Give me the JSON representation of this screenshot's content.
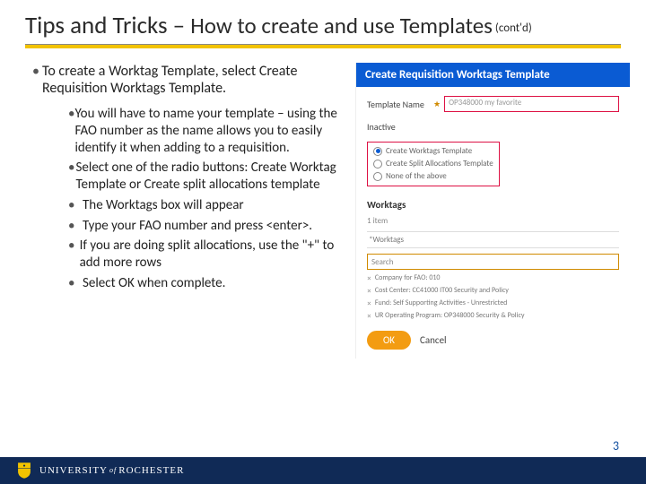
{
  "title": {
    "part1": "Tips and Tricks",
    "sep": " – ",
    "part2": "How to create and use Templates",
    "cont": " (cont'd)"
  },
  "bullets": {
    "top": "To create a Worktag Template, select Create Requisition Worktags Template.",
    "subs": [
      "You will have to name your template – using the FAO number as the name allows you to easily identify it when adding to a requisition.",
      "Select one of the radio buttons: Create Worktag Template or Create split allocations template",
      "The Worktags box will appear",
      "Type your FAO number and press <enter>.",
      "If you are doing split allocations, use the \"+\" to add more rows",
      "Select OK when complete."
    ]
  },
  "panel": {
    "header": "Create Requisition Worktags Template",
    "templateNameLabel": "Template Name",
    "templateNameValue": "OP348000 my favorite",
    "inactiveLabel": "Inactive",
    "radios": [
      "Create Worktags Template",
      "Create Split Allocations Template",
      "None of the above"
    ],
    "worktagsLabel": "Worktags",
    "itemsCount": "1 item",
    "wkHead": "*Worktags",
    "searchPlaceholder": "Search",
    "lines": [
      "Company for FAO: 010",
      "Cost Center: CC41000 IT00 Security and Policy",
      "Fund: Self Supporting Activities - Unrestricted",
      "UR Operating Program: OP348000 Security & Policy"
    ],
    "okLabel": "OK",
    "cancelLabel": "Cancel"
  },
  "footer": {
    "university": "UNIVERSITY",
    "of": "of",
    "rochester": "ROCHESTER",
    "page": "3"
  }
}
